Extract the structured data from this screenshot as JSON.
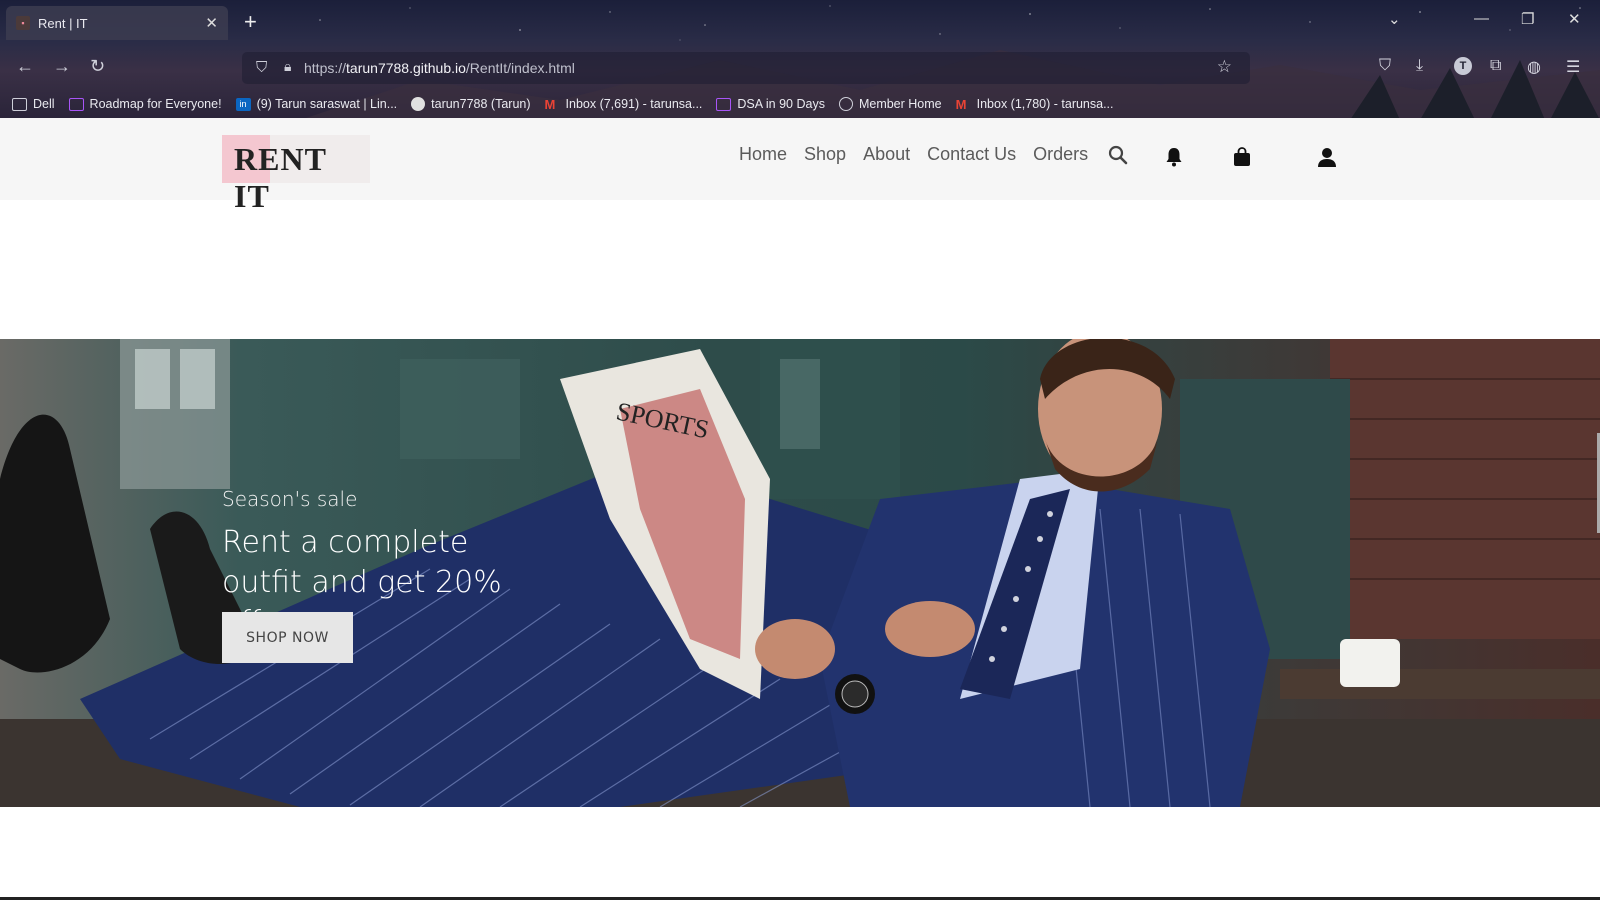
{
  "browser": {
    "tab_title": "Rent | IT",
    "new_tab_symbol": "+",
    "url_prefix": "https://",
    "url_domain": "tarun7788.github.io",
    "url_path": "/RentIt/index.html",
    "bookmarks": [
      {
        "label": "Dell",
        "icon": "folder-icon",
        "color": "#cfd0da"
      },
      {
        "label": "Roadmap for Everyone!",
        "icon": "roadmap-icon",
        "color": "#a855f7"
      },
      {
        "label": "(9) Tarun saraswat | Lin...",
        "icon": "linkedin-icon",
        "color": "#0a66c2"
      },
      {
        "label": "tarun7788 (Tarun)",
        "icon": "github-icon",
        "color": "#e0e0e0"
      },
      {
        "label": "Inbox (7,691) - tarunsa...",
        "icon": "gmail-icon",
        "color": "#ea4335"
      },
      {
        "label": "DSA in 90 Days",
        "icon": "dsa-icon",
        "color": "#a855f7"
      },
      {
        "label": "Member Home",
        "icon": "globe-icon",
        "color": "#cfd0da"
      },
      {
        "label": "Inbox (1,780) - tarunsa...",
        "icon": "gmail-icon",
        "color": "#ea4335"
      }
    ]
  },
  "site": {
    "logo_text": "RENT IT",
    "nav": [
      "Home",
      "Shop",
      "About",
      "Contact Us",
      "Orders"
    ]
  },
  "hero": {
    "subtitle": "Season's sale",
    "title": "Rent a complete outfit and get 20% off",
    "cta": "SHOP NOW"
  },
  "colors": {
    "logo_accent": "#f4c7d0",
    "header_bg": "#f6f6f6"
  }
}
